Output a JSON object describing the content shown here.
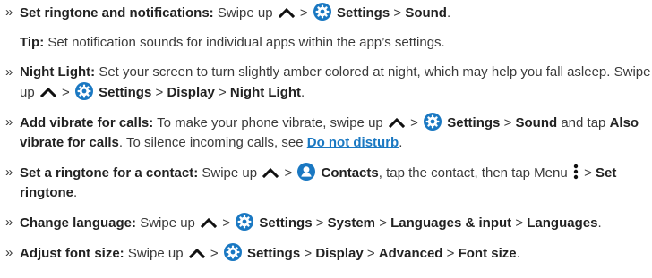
{
  "items": [
    {
      "bullet": "»",
      "title": "Set ringtone and notifications:",
      "t1": "Swipe up",
      "sep1": ">",
      "settings": "Settings",
      "sep2": ">",
      "sound": "Sound",
      "end": "."
    },
    {
      "tip_label": "Tip:",
      "tip_text": "Set notification sounds for individual apps within the app’s settings."
    },
    {
      "bullet": "»",
      "title": "Night Light:",
      "t1": "Set your screen to turn slightly amber colored at night, which may help you fall asleep. Swipe up",
      "sep1": ">",
      "settings": "Settings",
      "sep2": ">",
      "display": "Display",
      "sep3": ">",
      "night_light": "Night Light",
      "end": "."
    },
    {
      "bullet": "»",
      "title": "Add vibrate for calls:",
      "t1": "To make your phone vibrate, swipe up",
      "sep1": ">",
      "settings": "Settings",
      "sep2": ">",
      "sound": "Sound",
      "t2": "and tap",
      "also_vibrate": "Also vibrate for calls",
      "t3": ". To silence incoming calls, see",
      "link": "Do not disturb",
      "end": "."
    },
    {
      "bullet": "»",
      "title": "Set a ringtone for a contact:",
      "t1": "Swipe up",
      "sep1": ">",
      "contacts": "Contacts",
      "t2": ", tap the contact, then tap Menu",
      "sep2": ">",
      "set_ringtone": "Set ringtone",
      "end": "."
    },
    {
      "bullet": "»",
      "title": "Change language:",
      "t1": "Swipe up",
      "sep1": ">",
      "settings": "Settings",
      "sep2": ">",
      "system": "System",
      "sep3": ">",
      "lang_input": "Languages & input",
      "sep4": ">",
      "languages": "Languages",
      "end": "."
    },
    {
      "bullet": "»",
      "title": "Adjust font size:",
      "t1": "Swipe up",
      "sep1": ">",
      "settings": "Settings",
      "sep2": ">",
      "display": "Display",
      "sep3": ">",
      "advanced": "Advanced",
      "sep4": ">",
      "font_size": "Font size",
      "end": "."
    }
  ],
  "icons": {
    "swipe_up": "caret-up-icon",
    "settings": "settings-gear-icon",
    "contacts": "contacts-person-icon",
    "menu": "menu-dots-icon"
  },
  "colors": {
    "icon_blue": "#1a78c2",
    "link": "#1a78c2",
    "text": "#3a3a3a"
  }
}
